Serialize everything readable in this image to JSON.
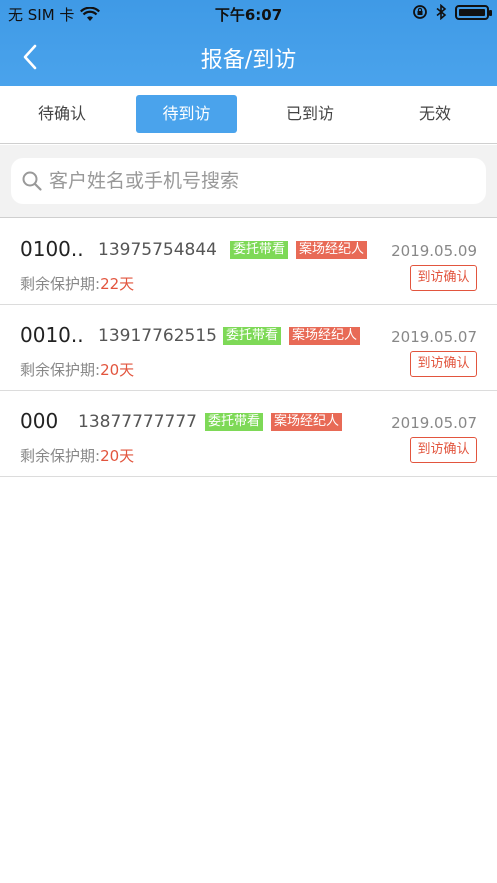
{
  "status_bar": {
    "carrier": "无 SIM 卡",
    "time": "下午6:07"
  },
  "navbar": {
    "title": "报备/到访"
  },
  "tabs": [
    {
      "label": "待确认",
      "active": false
    },
    {
      "label": "待到访",
      "active": true
    },
    {
      "label": "已到访",
      "active": false
    },
    {
      "label": "无效",
      "active": false
    }
  ],
  "search": {
    "placeholder": "客户姓名或手机号搜索",
    "value": ""
  },
  "protect_label": "剩余保护期:",
  "items": [
    {
      "name": "0100..",
      "phone": "13975754844",
      "tag1": "委托带看",
      "tag2": "案场经纪人",
      "date": "2019.05.09",
      "days": "22天",
      "action": "到访确认"
    },
    {
      "name": "0010..",
      "phone": "13917762515",
      "tag1": "委托带看",
      "tag2": "案场经纪人",
      "date": "2019.05.07",
      "days": "20天",
      "action": "到访确认"
    },
    {
      "name": "000",
      "phone": "13877777777",
      "tag1": "委托带看",
      "tag2": "案场经纪人",
      "date": "2019.05.07",
      "days": "20天",
      "action": "到访确认"
    }
  ],
  "colors": {
    "primary": "#4aa3ec",
    "tag_green": "#7ed957",
    "tag_red": "#e86a56",
    "accent_red": "#e2553e"
  }
}
